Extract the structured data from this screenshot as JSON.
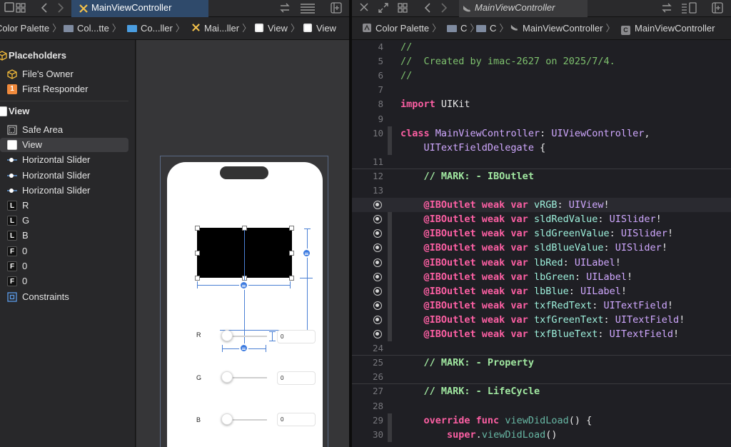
{
  "left_pane": {
    "tab_title": "MainViewController",
    "breadcrumbs": [
      "Color Palette",
      "Col...tte",
      "Co...ller",
      "Mai...ller",
      "View",
      "View"
    ],
    "outline": {
      "placeholders_header": "Placeholders",
      "files_owner": "File's Owner",
      "first_responder": "First Responder",
      "first_responder_badge": "1",
      "view_header": "View",
      "items": [
        {
          "label": "Safe Area",
          "icon": "safe-area-icon"
        },
        {
          "label": "View",
          "icon": "view-icon",
          "selected": true
        },
        {
          "label": "Horizontal Slider",
          "icon": "slider-icon"
        },
        {
          "label": "Horizontal Slider",
          "icon": "slider-icon"
        },
        {
          "label": "Horizontal Slider",
          "icon": "slider-icon"
        },
        {
          "label": "R",
          "icon": "label-icon",
          "badge": "L"
        },
        {
          "label": "G",
          "icon": "label-icon",
          "badge": "L"
        },
        {
          "label": "B",
          "icon": "label-icon",
          "badge": "L"
        },
        {
          "label": "0",
          "icon": "textfield-icon",
          "badge": "F"
        },
        {
          "label": "0",
          "icon": "textfield-icon",
          "badge": "F"
        },
        {
          "label": "0",
          "icon": "textfield-icon",
          "badge": "F"
        },
        {
          "label": "Constraints",
          "icon": "constraints-icon"
        }
      ]
    },
    "canvas": {
      "rows": [
        {
          "label": "R",
          "value": "0"
        },
        {
          "label": "G",
          "value": "0"
        },
        {
          "label": "B",
          "value": "0"
        }
      ],
      "swatch_color": "#000000"
    }
  },
  "right_pane": {
    "tab_title": "MainViewController",
    "breadcrumbs": [
      "Color Palette",
      "C",
      "C",
      "MainViewController",
      "MainViewController"
    ],
    "breadcrumb_file_badge": "C",
    "code_lines": [
      {
        "n": "4",
        "parts": [
          [
            "c-com",
            "//"
          ]
        ]
      },
      {
        "n": "5",
        "parts": [
          [
            "c-com",
            "//  Created by imac-2627 on 2025/7/4."
          ]
        ]
      },
      {
        "n": "6",
        "parts": [
          [
            "c-com",
            "//"
          ]
        ]
      },
      {
        "n": "7",
        "parts": []
      },
      {
        "n": "8",
        "parts": [
          [
            "c-kw",
            "import"
          ],
          [
            "c-plain",
            " UIKit"
          ]
        ]
      },
      {
        "n": "9",
        "parts": []
      },
      {
        "n": "10",
        "parts": [
          [
            "c-kw",
            "class"
          ],
          [
            "c-plain",
            " "
          ],
          [
            "c-type",
            "MainViewController"
          ],
          [
            "c-plain",
            ": "
          ],
          [
            "c-type",
            "UIViewController"
          ],
          [
            "c-plain",
            ","
          ]
        ]
      },
      {
        "n": "",
        "parts": [
          [
            "c-plain",
            "    "
          ],
          [
            "c-type",
            "UITextFieldDelegate"
          ],
          [
            "c-plain",
            " {"
          ]
        ]
      },
      {
        "n": "11",
        "parts": []
      },
      {
        "n": "12",
        "parts": [
          [
            "c-plain",
            "    "
          ],
          [
            "c-mark",
            "// MARK: - IBOutlet"
          ]
        ]
      },
      {
        "n": "13",
        "parts": []
      },
      {
        "n": "",
        "outlet": true,
        "hl": true,
        "parts": [
          [
            "c-plain",
            "    "
          ],
          [
            "c-kw",
            "@IBOutlet weak var"
          ],
          [
            "c-plain",
            " "
          ],
          [
            "c-prop",
            "vRGB"
          ],
          [
            "c-plain",
            ": "
          ],
          [
            "c-type",
            "UIView"
          ],
          [
            "c-plain",
            "!"
          ]
        ]
      },
      {
        "n": "",
        "outlet": true,
        "parts": [
          [
            "c-plain",
            "    "
          ],
          [
            "c-kw",
            "@IBOutlet weak var"
          ],
          [
            "c-plain",
            " "
          ],
          [
            "c-prop",
            "sldRedValue"
          ],
          [
            "c-plain",
            ": "
          ],
          [
            "c-type",
            "UISlider"
          ],
          [
            "c-plain",
            "!"
          ]
        ]
      },
      {
        "n": "",
        "outlet": true,
        "parts": [
          [
            "c-plain",
            "    "
          ],
          [
            "c-kw",
            "@IBOutlet weak var"
          ],
          [
            "c-plain",
            " "
          ],
          [
            "c-prop",
            "sldGreenValue"
          ],
          [
            "c-plain",
            ": "
          ],
          [
            "c-type",
            "UISlider"
          ],
          [
            "c-plain",
            "!"
          ]
        ]
      },
      {
        "n": "",
        "outlet": true,
        "parts": [
          [
            "c-plain",
            "    "
          ],
          [
            "c-kw",
            "@IBOutlet weak var"
          ],
          [
            "c-plain",
            " "
          ],
          [
            "c-prop",
            "sldBlueValue"
          ],
          [
            "c-plain",
            ": "
          ],
          [
            "c-type",
            "UISlider"
          ],
          [
            "c-plain",
            "!"
          ]
        ]
      },
      {
        "n": "",
        "outlet": true,
        "parts": [
          [
            "c-plain",
            "    "
          ],
          [
            "c-kw",
            "@IBOutlet weak var"
          ],
          [
            "c-plain",
            " "
          ],
          [
            "c-prop",
            "lbRed"
          ],
          [
            "c-plain",
            ": "
          ],
          [
            "c-type",
            "UILabel"
          ],
          [
            "c-plain",
            "!"
          ]
        ]
      },
      {
        "n": "",
        "outlet": true,
        "parts": [
          [
            "c-plain",
            "    "
          ],
          [
            "c-kw",
            "@IBOutlet weak var"
          ],
          [
            "c-plain",
            " "
          ],
          [
            "c-prop",
            "lbGreen"
          ],
          [
            "c-plain",
            ": "
          ],
          [
            "c-type",
            "UILabel"
          ],
          [
            "c-plain",
            "!"
          ]
        ]
      },
      {
        "n": "",
        "outlet": true,
        "parts": [
          [
            "c-plain",
            "    "
          ],
          [
            "c-kw",
            "@IBOutlet weak var"
          ],
          [
            "c-plain",
            " "
          ],
          [
            "c-prop",
            "lbBlue"
          ],
          [
            "c-plain",
            ": "
          ],
          [
            "c-type",
            "UILabel"
          ],
          [
            "c-plain",
            "!"
          ]
        ]
      },
      {
        "n": "",
        "outlet": true,
        "parts": [
          [
            "c-plain",
            "    "
          ],
          [
            "c-kw",
            "@IBOutlet weak var"
          ],
          [
            "c-plain",
            " "
          ],
          [
            "c-prop",
            "txfRedText"
          ],
          [
            "c-plain",
            ": "
          ],
          [
            "c-type",
            "UITextField"
          ],
          [
            "c-plain",
            "!"
          ]
        ]
      },
      {
        "n": "",
        "outlet": true,
        "parts": [
          [
            "c-plain",
            "    "
          ],
          [
            "c-kw",
            "@IBOutlet weak var"
          ],
          [
            "c-plain",
            " "
          ],
          [
            "c-prop",
            "txfGreenText"
          ],
          [
            "c-plain",
            ": "
          ],
          [
            "c-type",
            "UITextField"
          ],
          [
            "c-plain",
            "!"
          ]
        ]
      },
      {
        "n": "",
        "outlet": true,
        "parts": [
          [
            "c-plain",
            "    "
          ],
          [
            "c-kw",
            "@IBOutlet weak var"
          ],
          [
            "c-plain",
            " "
          ],
          [
            "c-prop",
            "txfBlueText"
          ],
          [
            "c-plain",
            ": "
          ],
          [
            "c-type",
            "UITextField"
          ],
          [
            "c-plain",
            "!"
          ]
        ]
      },
      {
        "n": "24",
        "parts": []
      },
      {
        "n": "25",
        "parts": [
          [
            "c-plain",
            "    "
          ],
          [
            "c-mark",
            "// MARK: - Property"
          ]
        ]
      },
      {
        "n": "26",
        "parts": []
      },
      {
        "n": "27",
        "parts": [
          [
            "c-plain",
            "    "
          ],
          [
            "c-mark",
            "// MARK: - LifeCycle"
          ]
        ]
      },
      {
        "n": "28",
        "parts": []
      },
      {
        "n": "29",
        "parts": [
          [
            "c-plain",
            "    "
          ],
          [
            "c-kw",
            "override func"
          ],
          [
            "c-plain",
            " "
          ],
          [
            "c-func",
            "viewDidLoad"
          ],
          [
            "c-plain",
            "() {"
          ]
        ]
      },
      {
        "n": "30",
        "parts": [
          [
            "c-plain",
            "        "
          ],
          [
            "c-kw",
            "super"
          ],
          [
            "c-plain",
            "."
          ],
          [
            "c-func",
            "viewDidLoad"
          ],
          [
            "c-plain",
            "()"
          ]
        ]
      }
    ]
  }
}
